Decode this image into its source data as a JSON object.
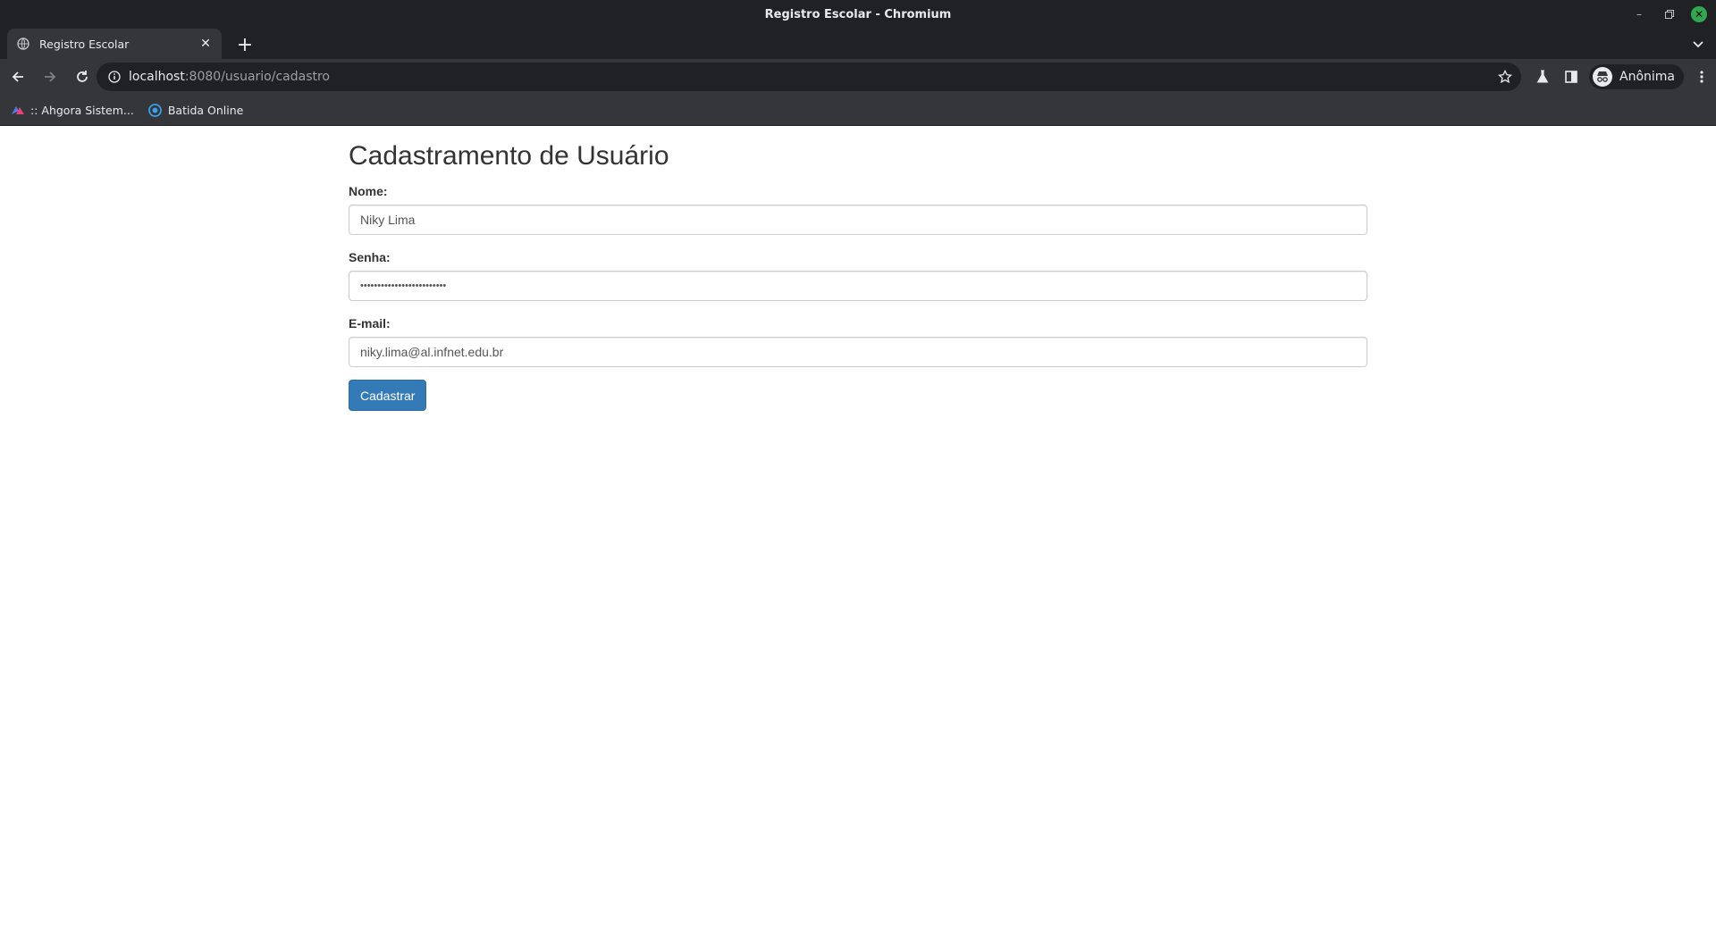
{
  "window": {
    "title": "Registro Escolar - Chromium"
  },
  "tabs": [
    {
      "title": "Registro Escolar",
      "active": true
    }
  ],
  "address_bar": {
    "host": "localhost",
    "path": ":8080/usuario/cadastro"
  },
  "profile": {
    "name": "Anônima"
  },
  "bookmarks": [
    {
      "label": ":: Ahgora Sistem...",
      "icon": "ahgora-icon"
    },
    {
      "label": "Batida Online",
      "icon": "batida-icon"
    }
  ],
  "form": {
    "title": "Cadastramento de Usuário",
    "nome_label": "Nome:",
    "nome_value": "Niky Lima",
    "senha_label": "Senha:",
    "senha_value": "•••••••••••••••••••••••••",
    "email_label": "E-mail:",
    "email_value": "niky.lima@al.infnet.edu.br",
    "submit_label": "Cadastrar"
  },
  "colors": {
    "primary_button": "#337ab7",
    "chrome_dark": "#202124",
    "chrome_toolbar": "#35363a"
  }
}
